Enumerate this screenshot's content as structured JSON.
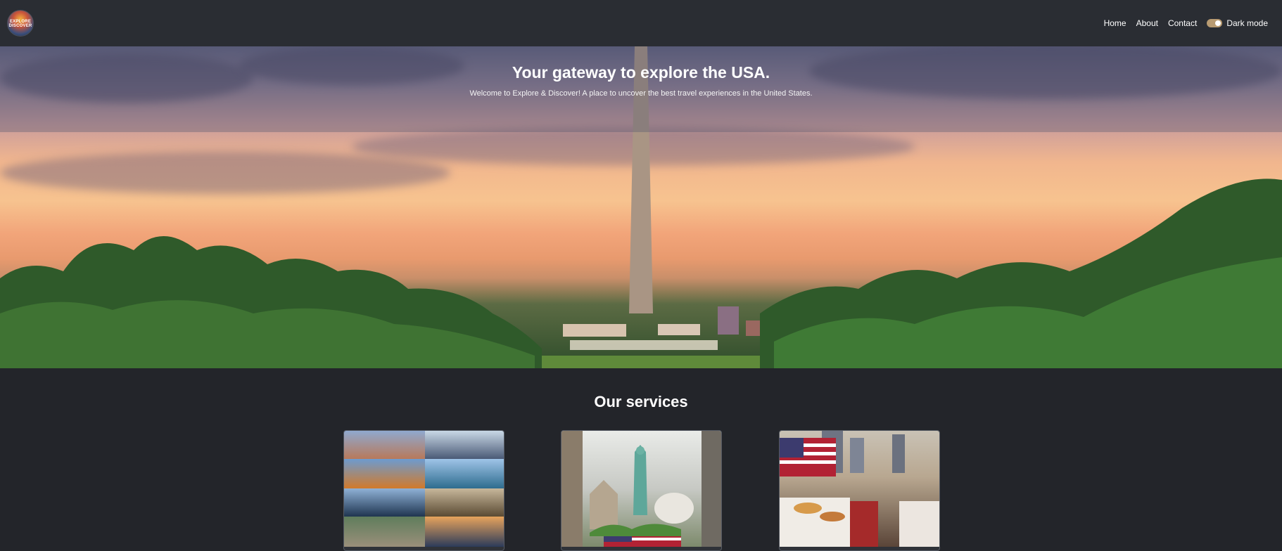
{
  "header": {
    "logo_lines": [
      "EXPLORE",
      "DISCOVER"
    ],
    "nav": [
      "Home",
      "About",
      "Contact"
    ],
    "dark_mode_label": "Dark mode",
    "dark_mode_on": true
  },
  "hero": {
    "title": "Your gateway to explore the USA.",
    "subtitle": "Welcome to Explore & Discover! A place to uncover the best travel experiences in the United States."
  },
  "services": {
    "title": "Our services",
    "cards": [
      {
        "image_name": "city-collage-image"
      },
      {
        "image_name": "statue-of-liberty-collage-image"
      },
      {
        "image_name": "american-dining-image"
      }
    ]
  },
  "colors": {
    "background": "#23252a",
    "navbar": "#2a2d33",
    "toggle": "#b89b72"
  }
}
